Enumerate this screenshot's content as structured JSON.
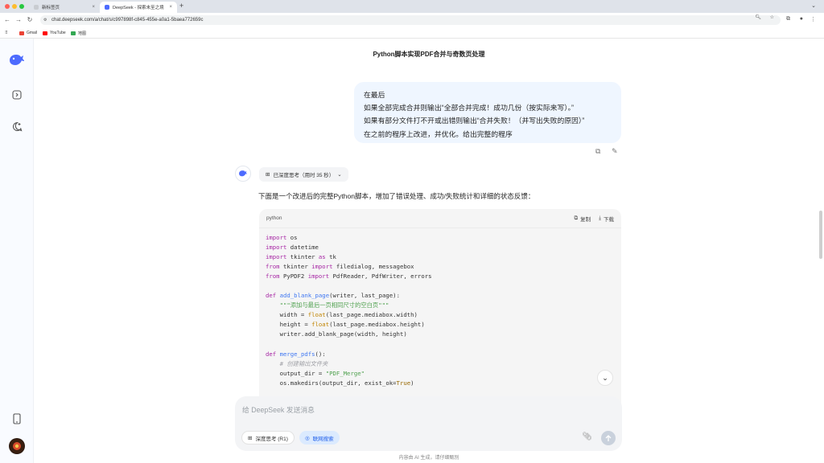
{
  "browser": {
    "tabs": [
      {
        "label": "新标签页",
        "active": false
      },
      {
        "label": "DeepSeek - 探索未至之境",
        "active": true
      }
    ],
    "url": "chat.deepseek.com/a/chat/s/c997898f-c845-455e-a0a1-5baea772659c",
    "bookmarks": [
      {
        "label": "Gmail"
      },
      {
        "label": "YouTube"
      },
      {
        "label": "地图"
      }
    ]
  },
  "conversation": {
    "title": "Python脚本实现PDF合并与奇数页处理",
    "user_message_lines": [
      "在最后",
      "如果全部完成合并则输出“全部合并完成！成功几份（按实际来写）。”",
      "如果有部分文件打不开或出错则输出“合并失败！（并写出失败的原因）”",
      "在之前的程序上改进，并优化。给出完整的程序"
    ],
    "think_pill_label": "已深度思考（用时 35 秒）",
    "ai_intro": "下面是一个改进后的完整Python脚本，增加了错误处理、成功/失败统计和详细的状态反馈：",
    "code": {
      "language": "python",
      "copy_label": "复制",
      "download_label": "下载",
      "lines": [
        "import os",
        "import datetime",
        "import tkinter as tk",
        "from tkinter import filedialog, messagebox",
        "from PyPDF2 import PdfReader, PdfWriter, errors",
        "",
        "def add_blank_page(writer, last_page):",
        "    \"\"\"添加与最后一页相同尺寸的空白页\"\"\"",
        "    width = float(last_page.mediabox.width)",
        "    height = float(last_page.mediabox.height)",
        "    writer.add_blank_page(width, height)",
        "",
        "def merge_pdfs():",
        "    # 创建输出文件夹",
        "    output_dir = \"PDF_Merge\"",
        "    os.makedirs(output_dir, exist_ok=True)"
      ]
    }
  },
  "composer": {
    "placeholder": "给 DeepSeek 发送消息",
    "deep_think_label": "深度思考 (R1)",
    "web_search_label": "联网搜索",
    "footer_note": "内容由 AI 生成，请仔细甄别"
  },
  "colors": {
    "accent": "#4d6bfe",
    "user_bubble": "#eff6ff",
    "search_chip_bg": "#dbeafe"
  }
}
